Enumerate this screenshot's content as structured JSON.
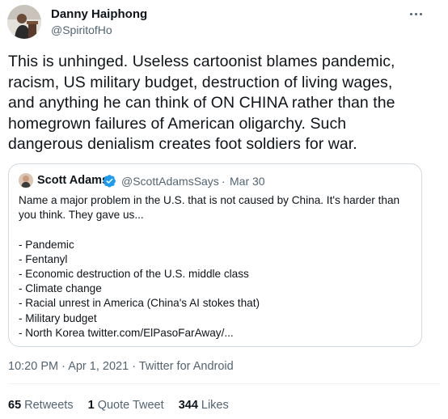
{
  "author": {
    "name": "Danny Haiphong",
    "handle": "@SpiritofHo"
  },
  "tweet": {
    "lines": [
      "This is unhinged. Useless cartoonist blames pandemic,",
      "racism, US military budget, destruction of living wages,",
      "and anything he can think of ON CHINA rather than the",
      "homegrown failures of American oligarchy. Such",
      "dangerous denialism creates foot soldiers for war."
    ]
  },
  "quoted": {
    "name": "Scott Adams",
    "handle": "@ScottAdamsSays",
    "separator": "·",
    "date": "Mar 30",
    "intro": [
      "Name a major problem in the U.S. that is not caused by China. It's harder than",
      "you think. They gave us..."
    ],
    "items": [
      "- Pandemic",
      "- Fentanyl",
      "- Economic destruction of the U.S. middle class",
      "- Climate change",
      "- Racial unrest in America (China's AI stokes that)",
      "- Military budget",
      "- North Korea twitter.com/ElPasoFarAway/..."
    ]
  },
  "meta": {
    "time": "10:20 PM",
    "sep1": "·",
    "date": "Apr 1, 2021",
    "sep2": "·",
    "source": "Twitter for Android"
  },
  "stats": {
    "retweets_count": "65",
    "retweets_label": "Retweets",
    "quotes_count": "1",
    "quotes_label": "Quote Tweet",
    "likes_count": "344",
    "likes_label": "Likes"
  },
  "colors": {
    "text": "#0f1419",
    "secondary": "#536471",
    "border": "#cfd9de",
    "verified": "#1d9bf0"
  },
  "icons": {
    "more": "more-horizontal-icon",
    "verified": "verified-badge-icon"
  }
}
